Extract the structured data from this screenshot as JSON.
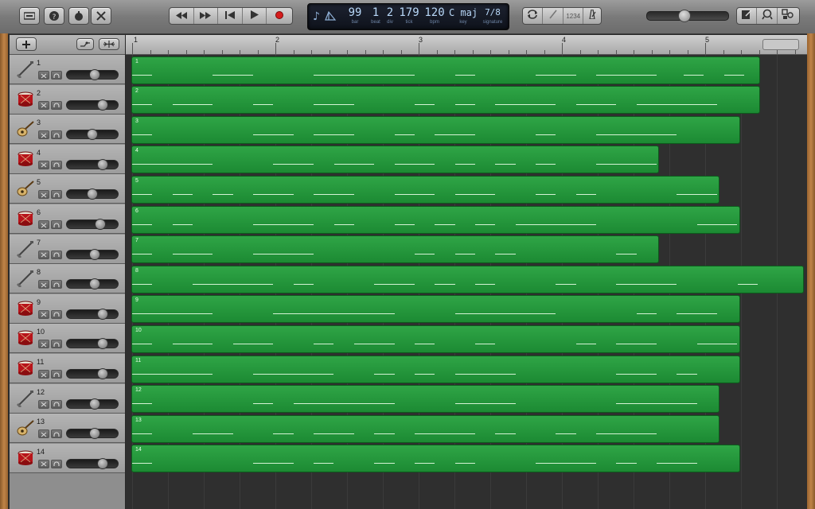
{
  "toolbar": {
    "left_buttons": [
      "library-icon",
      "help-icon",
      "smart-controls-icon",
      "editors-icon"
    ],
    "transport": [
      "rewind-icon",
      "fast-forward-icon",
      "go-to-beginning-icon",
      "play-icon",
      "record-icon"
    ],
    "right_buttons": [
      "cycle-icon",
      "tuner-icon",
      "count-in-icon",
      "metronome-icon"
    ],
    "count_in_label": "1234",
    "far_right": [
      "notepad-icon",
      "loop-browser-icon",
      "media-browser-icon"
    ]
  },
  "lcd": {
    "bar": "99",
    "bar_label": "bar",
    "beat": "1",
    "beat_label": "beat",
    "div": "2",
    "div_label": "div",
    "tick": "179",
    "tick_label": "tick",
    "bpm": "120",
    "bpm_label": "bpm",
    "key": "C maj",
    "key_label": "key",
    "signature": "7/8",
    "signature_label": "signature"
  },
  "ruler": {
    "bars": [
      "1",
      "2",
      "3",
      "4",
      "5"
    ]
  },
  "tracks": [
    {
      "num": "1",
      "instrument": "guitar",
      "vol": 0.55,
      "region_end": 0.935,
      "notes": [
        [
          0.0,
          0.03
        ],
        [
          0.12,
          0.18
        ],
        [
          0.27,
          0.42
        ],
        [
          0.48,
          0.51
        ],
        [
          0.6,
          0.66
        ],
        [
          0.69,
          0.78
        ],
        [
          0.82,
          0.85
        ],
        [
          0.88,
          0.91
        ]
      ]
    },
    {
      "num": "2",
      "instrument": "drum",
      "vol": 0.75,
      "region_end": 0.935,
      "notes": [
        [
          0.0,
          0.03
        ],
        [
          0.06,
          0.12
        ],
        [
          0.18,
          0.21
        ],
        [
          0.27,
          0.33
        ],
        [
          0.42,
          0.45
        ],
        [
          0.48,
          0.51
        ],
        [
          0.54,
          0.63
        ],
        [
          0.66,
          0.72
        ],
        [
          0.75,
          0.87
        ]
      ]
    },
    {
      "num": "3",
      "instrument": "mandolin",
      "vol": 0.5,
      "region_end": 0.905,
      "notes": [
        [
          0.0,
          0.03
        ],
        [
          0.18,
          0.24
        ],
        [
          0.27,
          0.33
        ],
        [
          0.39,
          0.42
        ],
        [
          0.45,
          0.51
        ],
        [
          0.6,
          0.63
        ],
        [
          0.69,
          0.81
        ]
      ]
    },
    {
      "num": "4",
      "instrument": "drum",
      "vol": 0.75,
      "region_end": 0.785,
      "notes": [
        [
          0.0,
          0.12
        ],
        [
          0.21,
          0.27
        ],
        [
          0.3,
          0.36
        ],
        [
          0.39,
          0.45
        ],
        [
          0.48,
          0.51
        ],
        [
          0.54,
          0.57
        ],
        [
          0.6,
          0.63
        ],
        [
          0.69,
          0.78
        ]
      ]
    },
    {
      "num": "5",
      "instrument": "mandolin",
      "vol": 0.5,
      "region_end": 0.875,
      "notes": [
        [
          0.0,
          0.03
        ],
        [
          0.06,
          0.09
        ],
        [
          0.12,
          0.15
        ],
        [
          0.18,
          0.24
        ],
        [
          0.27,
          0.33
        ],
        [
          0.39,
          0.45
        ],
        [
          0.48,
          0.54
        ],
        [
          0.6,
          0.63
        ],
        [
          0.66,
          0.69
        ],
        [
          0.81,
          0.87
        ]
      ]
    },
    {
      "num": "6",
      "instrument": "drum",
      "vol": 0.7,
      "region_end": 0.905,
      "notes": [
        [
          0.0,
          0.03
        ],
        [
          0.06,
          0.09
        ],
        [
          0.18,
          0.27
        ],
        [
          0.3,
          0.33
        ],
        [
          0.39,
          0.42
        ],
        [
          0.45,
          0.48
        ],
        [
          0.51,
          0.54
        ],
        [
          0.57,
          0.69
        ],
        [
          0.84,
          0.9
        ]
      ]
    },
    {
      "num": "7",
      "instrument": "guitar",
      "vol": 0.55,
      "region_end": 0.785,
      "notes": [
        [
          0.0,
          0.03
        ],
        [
          0.06,
          0.12
        ],
        [
          0.18,
          0.27
        ],
        [
          0.42,
          0.45
        ],
        [
          0.48,
          0.51
        ],
        [
          0.54,
          0.57
        ],
        [
          0.72,
          0.75
        ]
      ]
    },
    {
      "num": "8",
      "instrument": "guitar",
      "vol": 0.55,
      "region_end": 1.0,
      "notes": [
        [
          0.0,
          0.03
        ],
        [
          0.09,
          0.21
        ],
        [
          0.24,
          0.27
        ],
        [
          0.36,
          0.42
        ],
        [
          0.45,
          0.48
        ],
        [
          0.51,
          0.54
        ],
        [
          0.63,
          0.66
        ],
        [
          0.72,
          0.81
        ],
        [
          0.9,
          0.93
        ]
      ]
    },
    {
      "num": "9",
      "instrument": "drum",
      "vol": 0.75,
      "region_end": 0.905,
      "notes": [
        [
          0.0,
          0.12
        ],
        [
          0.21,
          0.39
        ],
        [
          0.48,
          0.63
        ],
        [
          0.75,
          0.78
        ],
        [
          0.81,
          0.87
        ]
      ]
    },
    {
      "num": "10",
      "instrument": "drum",
      "vol": 0.75,
      "region_end": 0.905,
      "notes": [
        [
          0.0,
          0.03
        ],
        [
          0.06,
          0.12
        ],
        [
          0.15,
          0.21
        ],
        [
          0.27,
          0.3
        ],
        [
          0.33,
          0.39
        ],
        [
          0.42,
          0.45
        ],
        [
          0.51,
          0.54
        ],
        [
          0.66,
          0.69
        ],
        [
          0.72,
          0.78
        ],
        [
          0.84,
          0.9
        ]
      ]
    },
    {
      "num": "11",
      "instrument": "drum",
      "vol": 0.75,
      "region_end": 0.905,
      "notes": [
        [
          0.0,
          0.12
        ],
        [
          0.18,
          0.3
        ],
        [
          0.36,
          0.39
        ],
        [
          0.42,
          0.45
        ],
        [
          0.48,
          0.57
        ],
        [
          0.72,
          0.78
        ],
        [
          0.81,
          0.84
        ]
      ]
    },
    {
      "num": "12",
      "instrument": "guitar",
      "vol": 0.55,
      "region_end": 0.875,
      "notes": [
        [
          0.0,
          0.03
        ],
        [
          0.18,
          0.21
        ],
        [
          0.24,
          0.39
        ],
        [
          0.48,
          0.57
        ],
        [
          0.72,
          0.84
        ]
      ]
    },
    {
      "num": "13",
      "instrument": "mandolin",
      "vol": 0.55,
      "region_end": 0.875,
      "notes": [
        [
          0.0,
          0.03
        ],
        [
          0.09,
          0.15
        ],
        [
          0.21,
          0.24
        ],
        [
          0.27,
          0.33
        ],
        [
          0.36,
          0.39
        ],
        [
          0.42,
          0.51
        ],
        [
          0.54,
          0.57
        ],
        [
          0.63,
          0.66
        ],
        [
          0.69,
          0.78
        ]
      ]
    },
    {
      "num": "14",
      "instrument": "drum",
      "vol": 0.75,
      "region_end": 0.905,
      "notes": [
        [
          0.0,
          0.03
        ],
        [
          0.18,
          0.24
        ],
        [
          0.27,
          0.3
        ],
        [
          0.36,
          0.39
        ],
        [
          0.42,
          0.45
        ],
        [
          0.48,
          0.51
        ],
        [
          0.6,
          0.69
        ],
        [
          0.72,
          0.75
        ],
        [
          0.78,
          0.84
        ]
      ]
    }
  ],
  "colors": {
    "region_green": "#26a13f",
    "note_line": "#d4f3d4",
    "lcd_text": "#b8d8f8"
  }
}
